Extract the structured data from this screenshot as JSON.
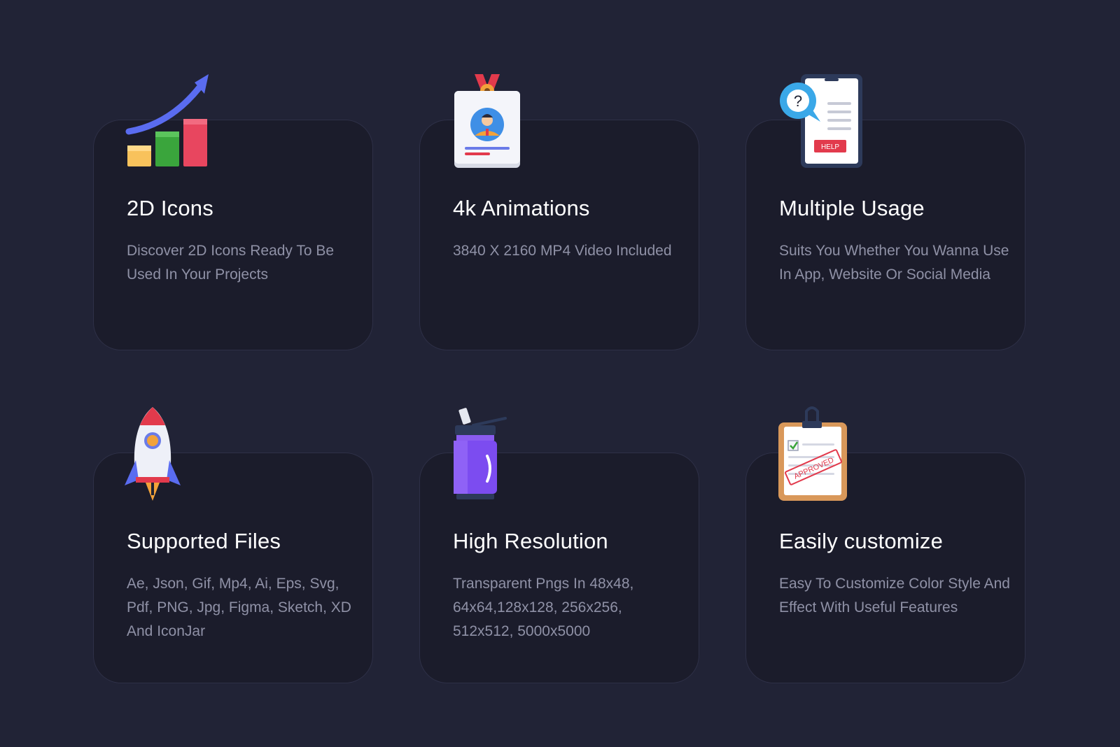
{
  "theme": {
    "background": "#212336",
    "card_background": "#1b1c2b",
    "card_border": "#2e3047",
    "title_color": "#ffffff",
    "text_color": "#8f91a6"
  },
  "features": [
    {
      "icon": "growth-chart-icon",
      "title": "2D Icons",
      "description": "Discover 2D Icons Ready To Be Used In Your Projects"
    },
    {
      "icon": "id-badge-icon",
      "title": "4k Animations",
      "description": "3840 X 2160 MP4 Video Included"
    },
    {
      "icon": "phone-help-icon",
      "title": "Multiple Usage",
      "description": "Suits You Whether You Wanna Use In App, Website Or Social Media",
      "icon_label": "HELP"
    },
    {
      "icon": "rocket-icon",
      "title": "Supported Files",
      "description": "Ae, Json, Gif, Mp4, Ai, Eps, Svg, Pdf, PNG, Jpg, Figma, Sketch, XD And IconJar"
    },
    {
      "icon": "water-bottle-icon",
      "title": "High Resolution",
      "description": "Transparent Pngs In 48x48, 64x64,128x128, 256x256, 512x512, 5000x5000"
    },
    {
      "icon": "approved-clipboard-icon",
      "title": "Easily customize",
      "description": "Easy To Customize Color Style And Effect With Useful Features",
      "icon_label": "APPROVED"
    }
  ]
}
